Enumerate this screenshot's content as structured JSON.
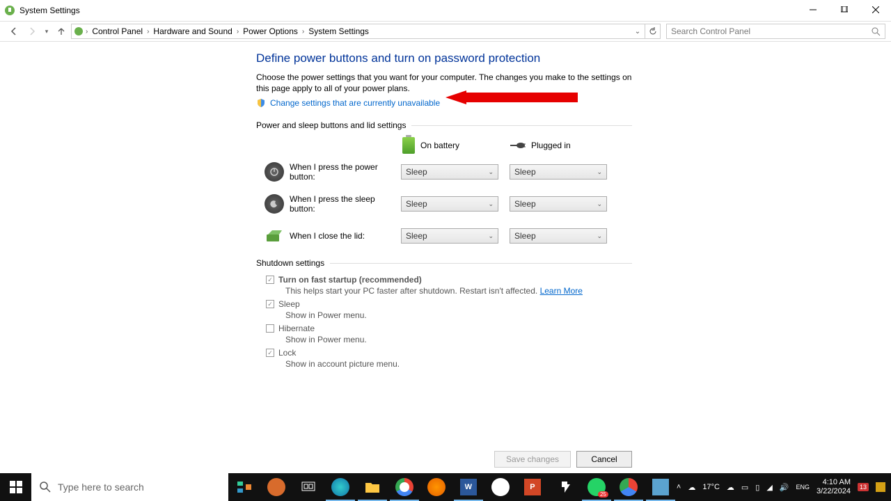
{
  "titlebar": {
    "title": "System Settings"
  },
  "nav": {
    "segments": [
      "Control Panel",
      "Hardware and Sound",
      "Power Options",
      "System Settings"
    ],
    "search_placeholder": "Search Control Panel"
  },
  "page": {
    "heading": "Define power buttons and turn on password protection",
    "description": "Choose the power settings that you want for your computer. The changes you make to the settings on this page apply to all of your power plans.",
    "change_link": "Change settings that are currently unavailable",
    "section1": "Power and sleep buttons and lid settings",
    "col_battery": "On battery",
    "col_plugged": "Plugged in",
    "rows": [
      {
        "label": "When I press the power button:",
        "bat": "Sleep",
        "plug": "Sleep"
      },
      {
        "label": "When I press the sleep button:",
        "bat": "Sleep",
        "plug": "Sleep"
      },
      {
        "label": "When I close the lid:",
        "bat": "Sleep",
        "plug": "Sleep"
      }
    ],
    "section2": "Shutdown settings",
    "shutdown": [
      {
        "label": "Turn on fast startup (recommended)",
        "desc": "This helps start your PC faster after shutdown. Restart isn't affected. ",
        "learn": "Learn More",
        "checked": true,
        "bold": true
      },
      {
        "label": "Sleep",
        "desc": "Show in Power menu.",
        "checked": true
      },
      {
        "label": "Hibernate",
        "desc": "Show in Power menu.",
        "checked": false
      },
      {
        "label": "Lock",
        "desc": "Show in account picture menu.",
        "checked": true
      }
    ]
  },
  "buttons": {
    "save": "Save changes",
    "cancel": "Cancel"
  },
  "taskbar": {
    "search_placeholder": "Type here to search",
    "weather_temp": "17°C",
    "time": "4:10 AM",
    "date": "3/22/2024",
    "notif_count": "13"
  }
}
